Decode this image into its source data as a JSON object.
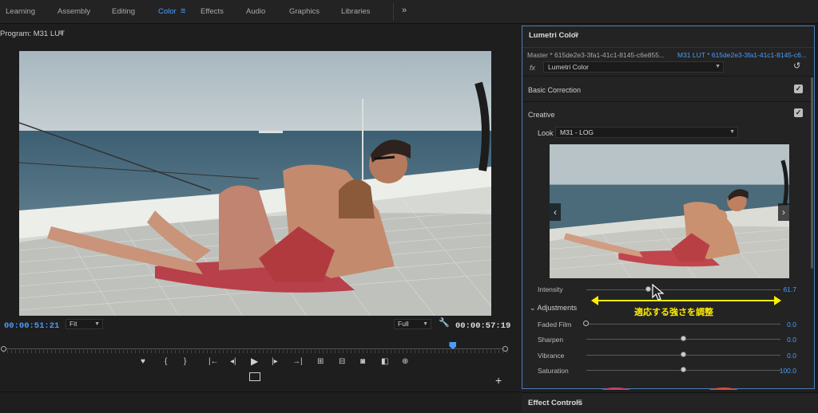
{
  "workspace_tabs": [
    {
      "label": "Learning",
      "active": false
    },
    {
      "label": "Assembly",
      "active": false
    },
    {
      "label": "Editing",
      "active": false
    },
    {
      "label": "Color",
      "active": true
    },
    {
      "label": "Effects",
      "active": false
    },
    {
      "label": "Audio",
      "active": false
    },
    {
      "label": "Graphics",
      "active": false
    },
    {
      "label": "Libraries",
      "active": false
    }
  ],
  "workspace_menu_icon": "hamburger-icon",
  "workspace_more": "»",
  "program": {
    "title": "Program: M31 LUT",
    "menu": "≡",
    "timecode_current": "00:00:51:21",
    "zoom": "Fit",
    "resolution": "Full",
    "timecode_duration": "00:00:57:19",
    "playhead_fraction": 0.89
  },
  "transport": {
    "marker": "♥",
    "in": "{",
    "out": "}",
    "go_in": "|←",
    "step_back": "◂|",
    "play": "▶",
    "step_forward": "|▸",
    "go_out": "→|",
    "lift": "⊞",
    "extract": "⊟",
    "camera": "◙",
    "compare": "◧",
    "safe": "⊕",
    "plus": "+"
  },
  "lumetri": {
    "title": "Lumetri Color",
    "menu": "≡",
    "master_tab": "Master * 615de2e3-3fa1-41c1-8145-c6e855...",
    "separator": "›",
    "clip_tab": "M31 LUT * 615de2e3-3fa1-41c1-8145-c6...",
    "fx_label": "fx",
    "effect_select": "Lumetri Color",
    "sections": {
      "basic_correction": "Basic Correction",
      "creative": "Creative"
    },
    "look_label": "Look",
    "look_value": "M31 - LOG",
    "intensity": {
      "label": "Intensity",
      "value": "61.7",
      "fraction": 0.32
    },
    "adjustments_title": "Adjustments",
    "params": [
      {
        "label": "Faded Film",
        "value": "0.0",
        "fraction": 0.0,
        "hollow": true
      },
      {
        "label": "Sharpen",
        "value": "0.0",
        "fraction": 0.5,
        "hollow": false
      },
      {
        "label": "Vibrance",
        "value": "0.0",
        "fraction": 0.5,
        "hollow": false
      },
      {
        "label": "Saturation",
        "value": "100.0",
        "fraction": 0.5,
        "hollow": false
      }
    ]
  },
  "annotation": {
    "text": "適応する強さを調整",
    "color": "#ffee00"
  },
  "effect_controls": {
    "title": "Effect Controls",
    "menu": "≡"
  },
  "colors": {
    "accent": "#4b9cff",
    "panel": "#232323",
    "background": "#1e1e1e"
  }
}
